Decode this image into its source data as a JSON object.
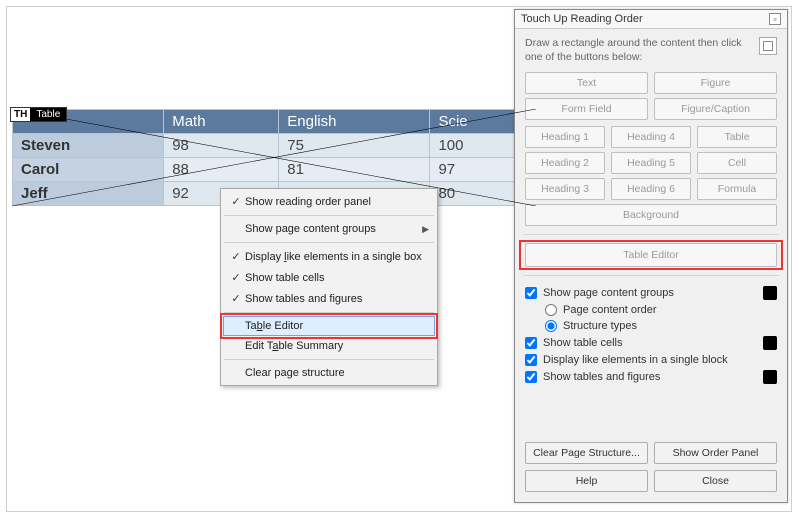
{
  "table": {
    "tag": {
      "th": "TH",
      "label": "Table"
    },
    "headers": [
      "",
      "Math",
      "English",
      "Scie"
    ],
    "rows": [
      {
        "name": "Steven",
        "vals": [
          "98",
          "75",
          "100"
        ]
      },
      {
        "name": "Carol",
        "vals": [
          "88",
          "81",
          "97"
        ]
      },
      {
        "name": "Jeff",
        "vals": [
          "92",
          "",
          "80"
        ]
      }
    ]
  },
  "contextMenu": {
    "items": [
      {
        "label": "Show reading order panel",
        "checked": true
      },
      {
        "label": "Show page content groups",
        "checked": false,
        "submenu": true
      },
      {
        "label_pre": "Display ",
        "access": "l",
        "label_post": "ike elements in a single box",
        "checked": true
      },
      {
        "label": "Show table cells",
        "checked": true
      },
      {
        "label": "Show tables and figures",
        "checked": true
      },
      {
        "label_pre": "Ta",
        "access": "b",
        "label_post": "le Editor",
        "checked": false,
        "highlight": true
      },
      {
        "label_pre": "Edit T",
        "access": "a",
        "label_post": "ble Summary",
        "checked": false
      },
      {
        "label": "Clear page structure",
        "checked": false
      }
    ]
  },
  "panel": {
    "title": "Touch Up Reading Order",
    "instruction": "Draw a rectangle around the content then click one of the buttons below:",
    "buttons": {
      "row12": [
        "Text",
        "Figure",
        "Form Field",
        "Figure/Caption"
      ],
      "row3": [
        "Heading 1",
        "Heading 4",
        "Table",
        "Heading 2",
        "Heading 5",
        "Cell",
        "Heading 3",
        "Heading 6",
        "Formula"
      ],
      "background": "Background",
      "tableEditor": "Table Editor"
    },
    "options": {
      "showGroups": "Show page content groups",
      "pageOrder": "Page content order",
      "structTypes": "Structure types",
      "showCells": "Show table cells",
      "displayLike": "Display like elements in a single block",
      "showTablesFigures": "Show tables and figures"
    },
    "footer": {
      "clear": "Clear Page Structure...",
      "showOrder": "Show Order Panel",
      "help": "Help",
      "close": "Close"
    }
  }
}
